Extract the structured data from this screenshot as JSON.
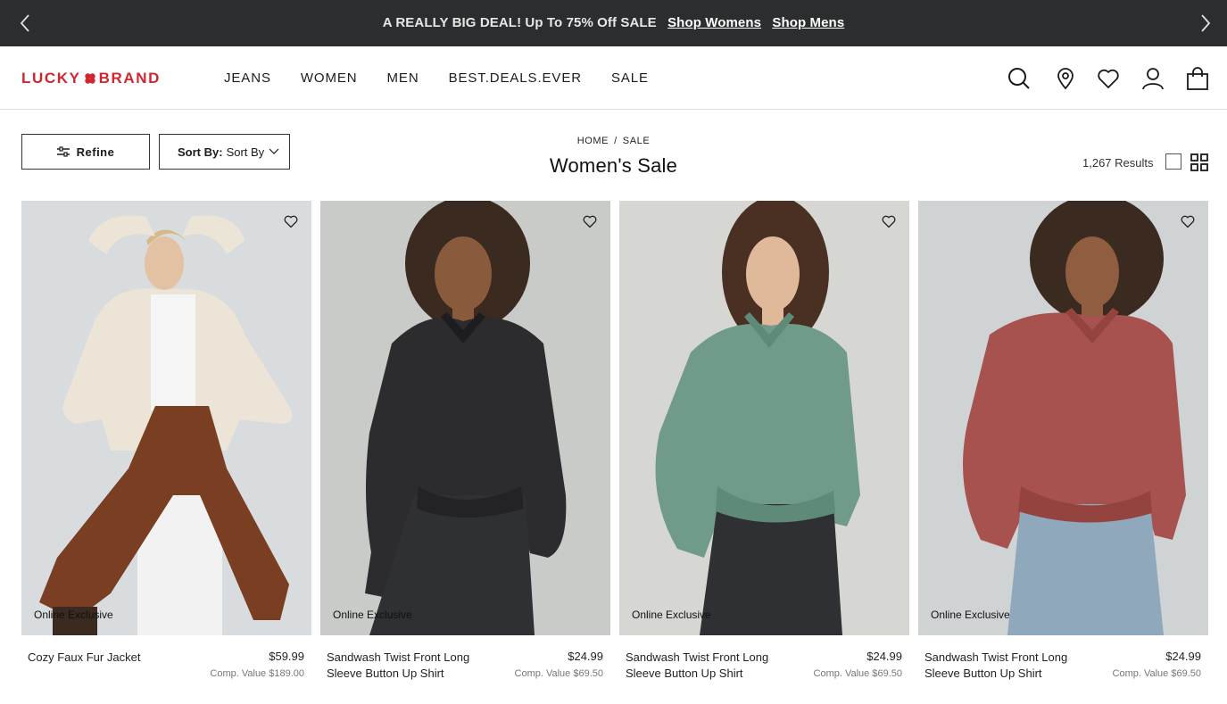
{
  "promo": {
    "message": "A REALLY BIG DEAL! Up To 75% Off SALE",
    "links": [
      "Shop Womens",
      "Shop Mens"
    ]
  },
  "header": {
    "logo_left": "LUCKY",
    "logo_right": "BRAND",
    "nav": [
      "JEANS",
      "WOMEN",
      "MEN",
      "BEST.DEALS.EVER",
      "SALE"
    ],
    "icons": [
      "search-icon",
      "store-locator-icon",
      "wishlist-icon",
      "account-icon",
      "bag-icon"
    ]
  },
  "toolbar": {
    "refine_label": "Refine",
    "sort_label": "Sort By:",
    "sort_value": "Sort By"
  },
  "breadcrumb": [
    "HOME",
    "SALE"
  ],
  "breadcrumb_separator": "/",
  "page_title": "Women's Sale",
  "results_text": "1,267 Results",
  "products": [
    {
      "badge": "Online Exclusive",
      "name": "Cozy Faux Fur Jacket",
      "price": "$59.99",
      "comp": "Comp. Value $189.00"
    },
    {
      "badge": "Online Exclusive",
      "name": "Sandwash Twist Front Long Sleeve Button Up Shirt",
      "price": "$24.99",
      "comp": "Comp. Value $69.50"
    },
    {
      "badge": "Online Exclusive",
      "name": "Sandwash Twist Front Long Sleeve Button Up Shirt",
      "price": "$24.99",
      "comp": "Comp. Value $69.50"
    },
    {
      "badge": "Online Exclusive",
      "name": "Sandwash Twist Front Long Sleeve Button Up Shirt",
      "price": "$24.99",
      "comp": "Comp. Value $69.50"
    }
  ],
  "colors": {
    "promo_bg": "#2b2d2f",
    "brand_red": "#d1262e",
    "shirt_black": "#2c2c2e",
    "shirt_green": "#6f9b88",
    "shirt_red": "#a7524f",
    "jacket_cream": "#ece4d6",
    "pants_brown": "#7a3e22"
  }
}
